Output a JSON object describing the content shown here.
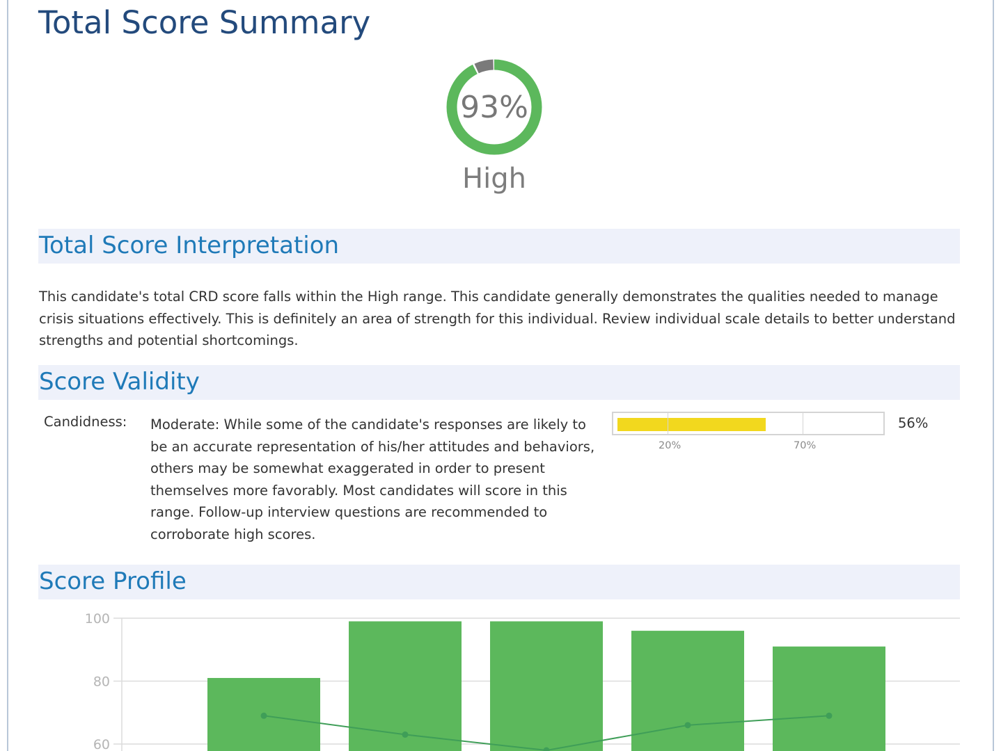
{
  "page_title": "Total Score Summary",
  "total_score": {
    "percent": 93,
    "display": "93%",
    "level": "High",
    "colors": {
      "score": "#5cb85c",
      "remainder": "#7a7a7a"
    }
  },
  "sections": {
    "interpretation": {
      "title": "Total Score Interpretation",
      "text": "This candidate's total CRD score falls within the High range. This candidate generally demonstrates the qualities needed to manage crisis situations effectively. This is definitely an area of strength for this individual. Review individual scale details to better understand strengths and potential shortcomings."
    },
    "validity": {
      "title": "Score Validity",
      "label": "Candidness:",
      "description": "Moderate: While some of the candidate's responses are likely to be an accurate representation of his/her attitudes and behaviors, others may be somewhat exaggerated in order to present themselves more favorably. Most candidates will score in this range. Follow-up interview questions are recommended to corroborate high scores.",
      "value": 56,
      "value_label": "56%",
      "thresholds": [
        {
          "value": 20,
          "label": "20%"
        },
        {
          "value": 70,
          "label": "70%"
        }
      ],
      "bar_color": "#f2d81e"
    },
    "profile": {
      "title": "Score Profile"
    }
  },
  "chart_data": {
    "type": "bar",
    "categories": [
      "",
      "",
      "",
      "",
      ""
    ],
    "series": [
      {
        "values": [
          81,
          99,
          99,
          96,
          91
        ],
        "color": "#5cb85c"
      },
      {
        "values": [
          69,
          63,
          58,
          66,
          69
        ],
        "type": "line",
        "color": "#3f9e58"
      }
    ],
    "y_ticks": [
      "60",
      "80",
      "100"
    ],
    "ylim": [
      60,
      100
    ],
    "grid": true
  }
}
